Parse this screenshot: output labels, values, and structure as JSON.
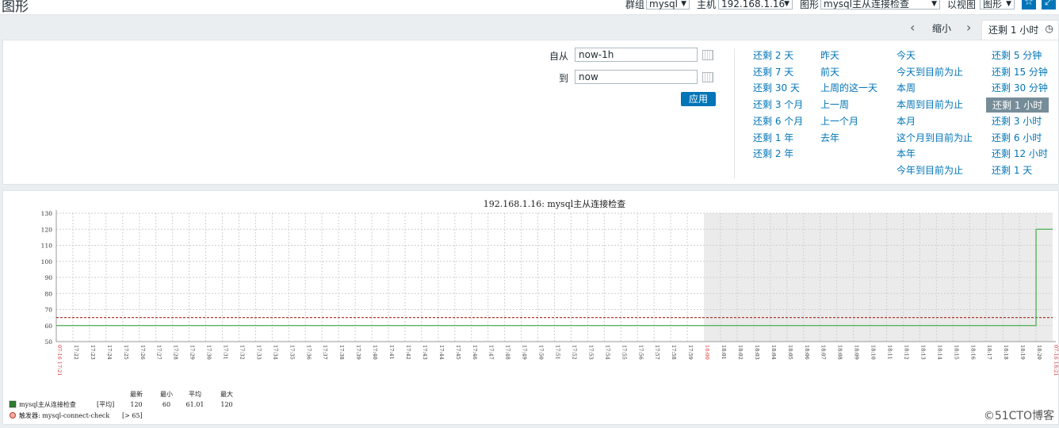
{
  "header": {
    "title": "图形",
    "group_label": "群组",
    "group_value": "mysql",
    "host_label": "主机",
    "host_value": "192.168.1.16",
    "graph_label": "图形",
    "graph_value": "mysql主从连接检查",
    "view_label": "以视图",
    "view_value": "图形"
  },
  "timenav": {
    "zoom_out": "缩小",
    "active_range": "还剩 1 小时"
  },
  "filter": {
    "from_label": "自从",
    "from_value": "now-1h",
    "to_label": "到",
    "to_value": "now",
    "apply": "应用",
    "col1": [
      "还剩 2 天",
      "还剩 7 天",
      "还剩 30 天",
      "还剩 3 个月",
      "还剩 6 个月",
      "还剩 1 年",
      "还剩 2 年"
    ],
    "col2": [
      "昨天",
      "前天",
      "上周的这一天",
      "上一周",
      "上一个月",
      "去年"
    ],
    "col3": [
      "今天",
      "今天到目前为止",
      "本周",
      "本周到目前为止",
      "本月",
      "这个月到目前为止",
      "本年",
      "今年到目前为止"
    ],
    "col4": [
      "还剩 5 分钟",
      "还剩 15 分钟",
      "还剩 30 分钟",
      "还剩 1 小时",
      "还剩 3 小时",
      "还剩 6 小时",
      "还剩 12 小时",
      "还剩 1 天"
    ],
    "active_item": "还剩 1 小时"
  },
  "chart_data": {
    "type": "line",
    "title": "192.168.1.16: mysql主从连接检查",
    "ylim": [
      50,
      130
    ],
    "y_ticks": [
      "130",
      "120",
      "110",
      "100",
      "90",
      "80",
      "70",
      "60",
      "50"
    ],
    "x_start_label": "07-16 17:21",
    "x_end_label": "07-16 18:21",
    "x_mid_label": "18:00",
    "x_ticks": [
      "17:22",
      "17:23",
      "17:24",
      "17:25",
      "17:26",
      "17:27",
      "17:28",
      "17:29",
      "17:30",
      "17:31",
      "17:32",
      "17:33",
      "17:34",
      "17:35",
      "17:36",
      "17:37",
      "17:38",
      "17:39",
      "17:40",
      "17:41",
      "17:42",
      "17:43",
      "17:44",
      "17:45",
      "17:46",
      "17:47",
      "17:48",
      "17:49",
      "17:50",
      "17:51",
      "17:52",
      "17:53",
      "17:54",
      "17:55",
      "17:56",
      "17:57",
      "17:58",
      "17:59",
      "18:01",
      "18:02",
      "18:03",
      "18:04",
      "18:05",
      "18:06",
      "18:07",
      "18:08",
      "18:09",
      "18:10",
      "18:11",
      "18:12",
      "18:13",
      "18:14",
      "18:15",
      "18:16",
      "18:17",
      "18:18",
      "18:19",
      "18:20"
    ],
    "shaded_from": "18:00",
    "series": [
      {
        "name": "mysql主从连接检查",
        "color": "#4caf50",
        "points": [
          [
            "17:21",
            60
          ],
          [
            "18:20",
            60
          ],
          [
            "18:20",
            120
          ],
          [
            "18:21",
            120
          ]
        ]
      }
    ],
    "trigger_value": 65,
    "trigger_color": "#b23a2c",
    "grid": true
  },
  "legend": {
    "headers": [
      "最新",
      "最小",
      "平均",
      "最大"
    ],
    "item_name": "mysql主从连接检查",
    "item_func": "[平均]",
    "item_values": [
      "120",
      "60",
      "61.01",
      "120"
    ],
    "trigger_label": "触发器: mysql-connect-check",
    "trigger_cond": "[> 65]",
    "series_color": "#2e7d32",
    "trigger_color": "#c0392b"
  },
  "watermark": "©51CTO博客"
}
